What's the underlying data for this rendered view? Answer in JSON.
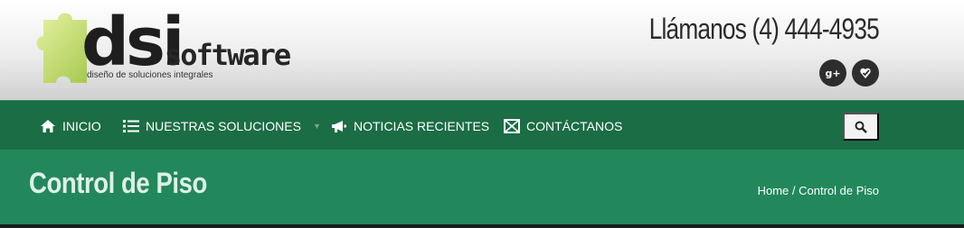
{
  "header": {
    "logo": {
      "brand_main": "dsi",
      "brand_sub": "software",
      "tagline": "diseño de soluciones integrales"
    },
    "phone": "Llámanos (4) 444-4935",
    "social": [
      {
        "name": "google-plus-icon",
        "label": "g+"
      },
      {
        "name": "foursquare-icon",
        "label": "✔"
      }
    ]
  },
  "nav": {
    "items": [
      {
        "label": "INICIO",
        "icon": "home-icon"
      },
      {
        "label": "NUESTRAS SOLUCIONES",
        "icon": "list-icon",
        "has_dropdown": true
      },
      {
        "label": "NOTICIAS RECIENTES",
        "icon": "megaphone-icon"
      },
      {
        "label": "CONTÁCTANOS",
        "icon": "envelope-icon"
      }
    ],
    "search_icon": "search-icon"
  },
  "titlebar": {
    "title": "Control de Piso",
    "breadcrumb": "Home / Control de Piso"
  },
  "colors": {
    "nav_bg": "#1b6d45",
    "title_bg": "#22885b",
    "logo_green": "#b7d65a"
  }
}
